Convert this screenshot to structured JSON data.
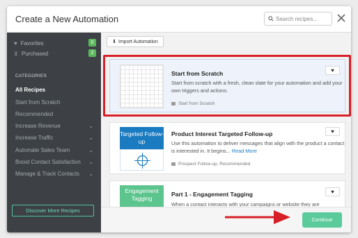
{
  "dialog": {
    "title": "Create a New Automation"
  },
  "search": {
    "placeholder": "Search recipes..."
  },
  "sidebar": {
    "favorites": {
      "label": "Favorites",
      "count": "0"
    },
    "purchased": {
      "label": "Purchased",
      "count": "2"
    },
    "categories_heading": "CATEGORIES",
    "categories": [
      {
        "label": "All Recipes",
        "active": true,
        "has_chevron": false
      },
      {
        "label": "Start from Scratch",
        "active": false,
        "has_chevron": false
      },
      {
        "label": "Recommended",
        "active": false,
        "has_chevron": false
      },
      {
        "label": "Increase Revenue",
        "active": false,
        "has_chevron": true
      },
      {
        "label": "Increase Traffic",
        "active": false,
        "has_chevron": true
      },
      {
        "label": "Automate Sales Team",
        "active": false,
        "has_chevron": true
      },
      {
        "label": "Boost Contact Satisfaction",
        "active": false,
        "has_chevron": true
      },
      {
        "label": "Manage & Track Contacts",
        "active": false,
        "has_chevron": true
      }
    ],
    "discover_label": "Discover More Recipes"
  },
  "main": {
    "import_label": "Import Automation",
    "cards": [
      {
        "title": "Start from Scratch",
        "description": "Start from scratch with a fresh, clean slate for your automation and add your own triggers and actions.",
        "tag": "Start from Scratch"
      },
      {
        "thumb_text": "Targeted Follow-up",
        "title": "Product Interest Targeted Follow-up",
        "description": "Use this automation to deliver messages that align with the product a contact is interested in. It begins...",
        "read_more": "Read More",
        "tag": "Prospect Follow-up, Recommended"
      },
      {
        "thumb_text": "Engagement Tagging",
        "title": "Part 1 - Engagement Tagging",
        "description": "When a contact interacts with your campaigns or website they are"
      }
    ],
    "continue_label": "Continue"
  },
  "icons": {
    "heart": "heart-icon",
    "close": "close-icon",
    "search": "search-icon",
    "tag": "tag-icon"
  },
  "colors": {
    "sidebar_bg": "#3d4145",
    "accent_green": "#5ccb9b",
    "badge_green": "#5cb85c",
    "brand_blue": "#1a7bc0",
    "highlight_red": "#d71f27",
    "selected_card_bg": "#edf2fb"
  }
}
